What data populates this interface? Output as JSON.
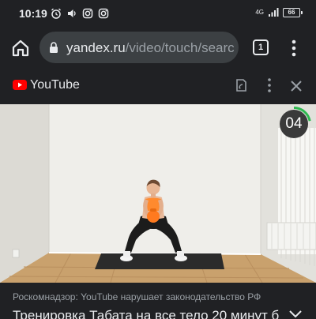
{
  "status_bar": {
    "time": "10:19",
    "network": "4G",
    "battery": "66",
    "icons": [
      "alarm-icon",
      "volume-icon",
      "instagram-icon",
      "instagram-icon",
      "signal-icon",
      "battery-icon"
    ]
  },
  "browser": {
    "url_host": "yandex.ru",
    "url_path": "/video/touch/searc",
    "tab_count": "1",
    "icons": [
      "home-icon",
      "lock-icon",
      "tab-switcher-icon",
      "menu-icon"
    ]
  },
  "sheet": {
    "title": "YouTube",
    "icons": [
      "youtube-logo-icon",
      "open-in-app-icon",
      "more-icon",
      "close-icon"
    ]
  },
  "video": {
    "countdown": "04",
    "countdown_progress": 0.22,
    "colors": {
      "timer_ring": "#2eb84f",
      "timer_bg": "#3a3a3a"
    }
  },
  "info": {
    "notice": "Роскомнадзор: YouTube нарушает законодательство РФ",
    "title": "Тренировка Табата на все тело 20 минут б",
    "icons": [
      "chevron-down-icon"
    ]
  }
}
